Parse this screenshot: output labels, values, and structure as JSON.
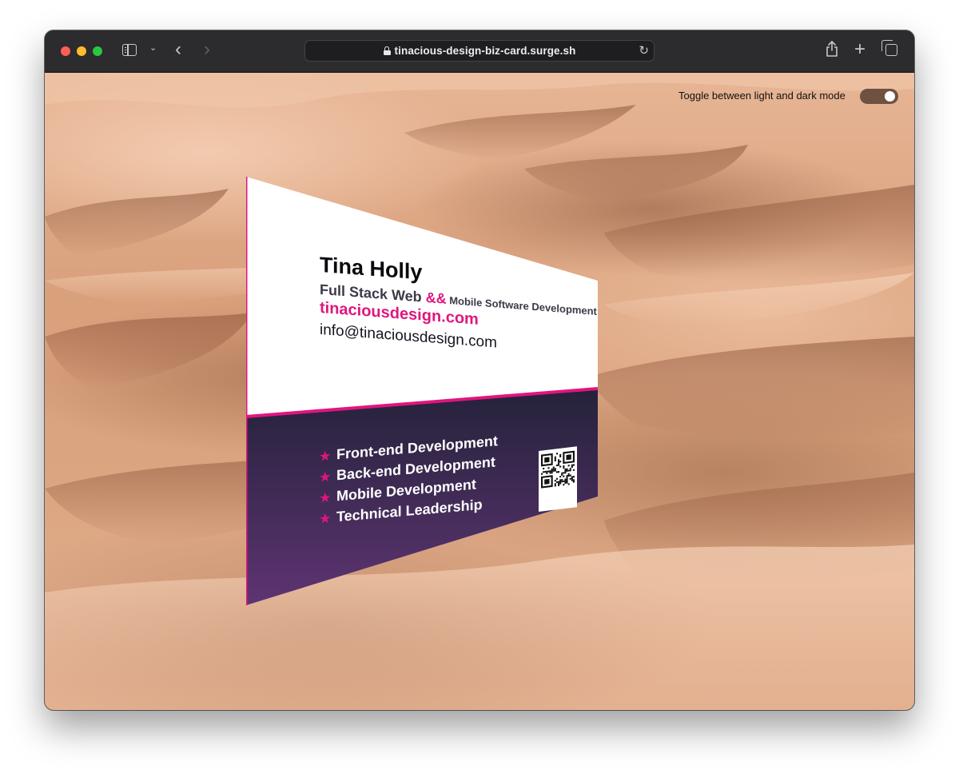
{
  "browser": {
    "url": "tinacious-design-biz-card.surge.sh",
    "icons": [
      "sidebar-icon",
      "chevron-down-icon",
      "back-icon",
      "forward-icon",
      "lock-icon",
      "reload-icon",
      "share-icon",
      "plus-icon",
      "tabs-icon"
    ]
  },
  "page": {
    "toggle_label": "Toggle between light and dark mode",
    "toggle_state": "dark"
  },
  "card": {
    "name": "Tina Holly",
    "title_part1": "Full Stack Web ",
    "title_amp": "&&",
    "title_part2": " Mobile Software Development",
    "website": "tinaciousdesign.com",
    "email": "info@tinaciousdesign.com",
    "skills": [
      "Front-end Development",
      "Back-end Development",
      "Mobile Development",
      "Technical Leadership"
    ],
    "bullet_glyph": "★",
    "colors": {
      "accent": "#e0157f",
      "dark_top": "#24223a",
      "dark_bottom": "#5e3472"
    }
  }
}
